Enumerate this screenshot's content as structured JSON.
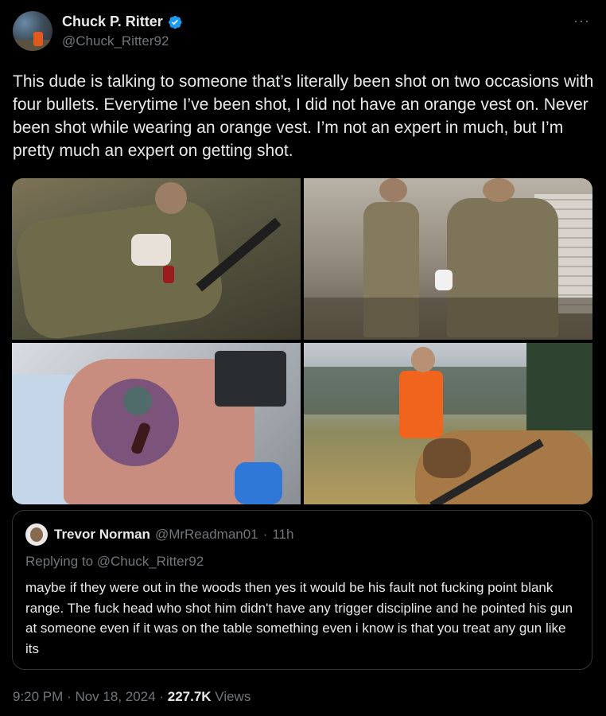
{
  "author": {
    "display_name": "Chuck P. Ritter",
    "handle": "@Chuck_Ritter92",
    "verified": true
  },
  "more_icon": "···",
  "tweet": {
    "text": "This dude is talking to someone that’s literally been shot on two occasions with four bullets. Everytime I’ve been shot, I did not have an orange vest on. Never been shot while wearing an orange vest. I’m not an expert in much, but I’m pretty much an expert on getting shot."
  },
  "media": [
    {
      "description": "soldier-wounded-on-ground"
    },
    {
      "description": "two-soldiers-standing"
    },
    {
      "description": "bruised-back-wound"
    },
    {
      "description": "hunter-orange-vest-with-elk"
    }
  ],
  "quote": {
    "display_name": "Trevor Norman",
    "handle": "@MrReadman01",
    "separator": "·",
    "time": "11h",
    "replying_to": "Replying to @Chuck_Ritter92",
    "text": "maybe if they were out in the woods then yes it would be his fault not fucking point blank range. The fuck head who shot him didn't have any trigger discipline and he pointed his gun at someone even if it was on the table something even i know is that you treat any gun like its"
  },
  "footer": {
    "time": "9:20 PM",
    "date": "Nov 18, 2024",
    "views_count": "227.7K",
    "views_label": "Views",
    "separator": "·"
  },
  "colors": {
    "background": "#000000",
    "text": "#e7e9ea",
    "muted": "#71767b",
    "verified": "#1d9bf0",
    "border": "#333639"
  }
}
